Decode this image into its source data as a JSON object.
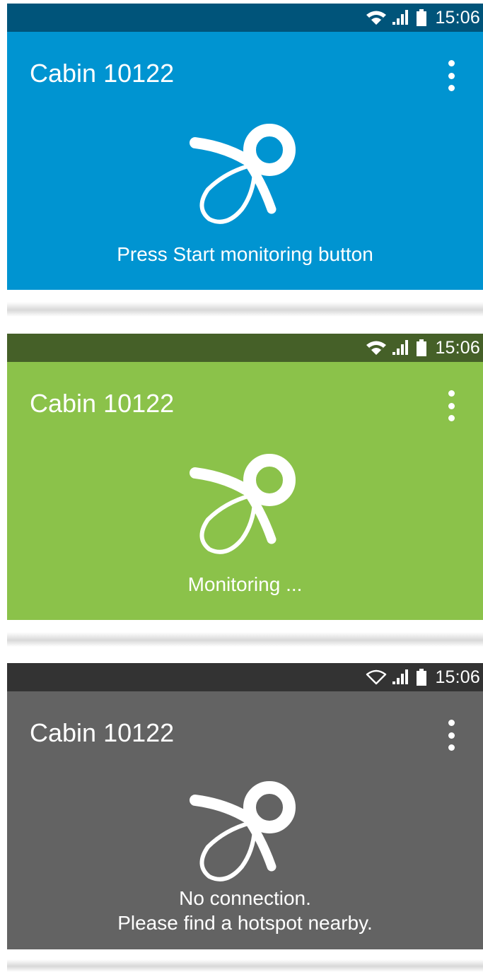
{
  "panels": [
    {
      "status": {
        "time": "15:06",
        "wifi": "wifi-full-icon",
        "signal": "signal-icon",
        "battery": "battery-icon"
      },
      "title": "Cabin 10122",
      "menu_icon": "overflow-menu-icon",
      "illustration": "pacifier-icon",
      "message": "Press Start monitoring button",
      "message_line2": "",
      "colors": {
        "statusbar": "#00547a",
        "appbar": "#0094d1"
      }
    },
    {
      "status": {
        "time": "15:06",
        "wifi": "wifi-full-icon",
        "signal": "signal-icon",
        "battery": "battery-icon"
      },
      "title": "Cabin 10122",
      "menu_icon": "overflow-menu-icon",
      "illustration": "pacifier-icon",
      "message": "Monitoring ...",
      "message_line2": "",
      "colors": {
        "statusbar": "#456028",
        "appbar": "#8bc24a"
      }
    },
    {
      "status": {
        "time": "15:06",
        "wifi": "wifi-empty-icon",
        "signal": "signal-icon",
        "battery": "battery-icon"
      },
      "title": "Cabin 10122",
      "menu_icon": "overflow-menu-icon",
      "illustration": "pacifier-icon",
      "message": "No connection.",
      "message_line2": "Please find a hotspot nearby.",
      "colors": {
        "statusbar": "#333333",
        "appbar": "#636363"
      }
    }
  ]
}
